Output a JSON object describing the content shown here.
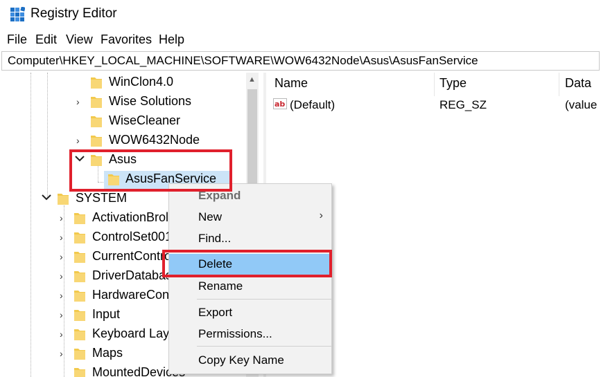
{
  "window": {
    "title": "Registry Editor",
    "app_icon": "registry-icon"
  },
  "menu": [
    "File",
    "Edit",
    "View",
    "Favorites",
    "Help"
  ],
  "address": "Computer\\HKEY_LOCAL_MACHINE\\SOFTWARE\\WOW6432Node\\Asus\\AsusFanService",
  "tree": {
    "items": [
      {
        "label": "WinClon4.0",
        "chevron": ""
      },
      {
        "label": "Wise Solutions",
        "chevron": "›"
      },
      {
        "label": "WiseCleaner",
        "chevron": ""
      },
      {
        "label": "WOW6432Node",
        "chevron": "›"
      },
      {
        "label": "Asus",
        "chevron": "⌄"
      },
      {
        "label": "AsusFanService",
        "chevron": ""
      },
      {
        "label": "SYSTEM",
        "chevron": "⌄"
      },
      {
        "label": "ActivationBrol",
        "chevron": "›"
      },
      {
        "label": "ControlSet001",
        "chevron": "›"
      },
      {
        "label": "CurrentContro",
        "chevron": "›"
      },
      {
        "label": "DriverDatabas",
        "chevron": "›"
      },
      {
        "label": "HardwareCon",
        "chevron": "›"
      },
      {
        "label": "Input",
        "chevron": "›"
      },
      {
        "label": "Keyboard Layo",
        "chevron": "›"
      },
      {
        "label": "Maps",
        "chevron": "›"
      },
      {
        "label": "MountedDevices",
        "chevron": ""
      }
    ]
  },
  "list": {
    "columns": [
      "Name",
      "Type",
      "Data"
    ],
    "rows": [
      {
        "name": "(Default)",
        "type": "REG_SZ",
        "data": "(value"
      }
    ]
  },
  "context_menu": {
    "expand": "Expand",
    "new": "New",
    "find": "Find...",
    "delete": "Delete",
    "rename": "Rename",
    "export": "Export",
    "permissions": "Permissions...",
    "copy_key_name": "Copy Key Name"
  },
  "colors": {
    "highlight": "#91c9f7",
    "selection": "#cce4f7",
    "annotation": "#e0202c",
    "folder": "#f2c94c"
  }
}
